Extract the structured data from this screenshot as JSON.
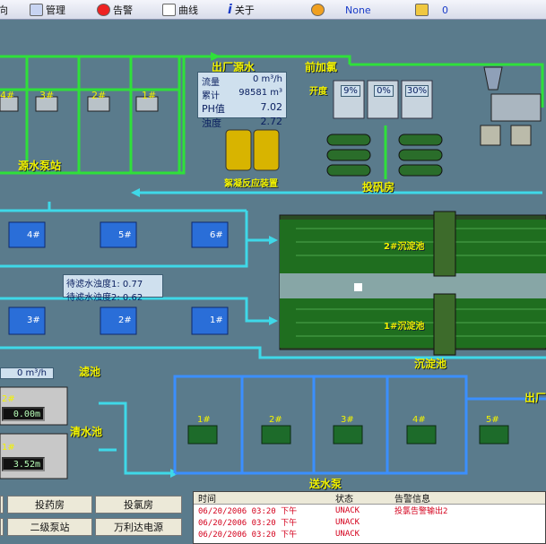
{
  "toolbar": {
    "partial_left": "向",
    "manage": "管理",
    "alarm": "告警",
    "curve": "曲线",
    "about": "关于",
    "user": "None",
    "count": "0"
  },
  "labels": {
    "source_station": "源水泵站",
    "outlet_water": "出厂源水",
    "front_chlorine": "前加氯",
    "open": "开度",
    "dosing_room": "投矾房",
    "filter": "滤池",
    "sed_tank": "沉淀池",
    "clear_pool": "清水池",
    "pump_station": "送水泵",
    "outlet": "出厂",
    "stirrer": "絮凝反应装置",
    "sed_2": "2#沉淀池",
    "sed_1": "1#沉淀池"
  },
  "outlet_stats": {
    "rows": [
      {
        "label": "流量",
        "value": "0",
        "unit": "m³/h"
      },
      {
        "label": "累计",
        "value": "98581",
        "unit": "m³"
      },
      {
        "label": "PH值",
        "value": "7.02",
        "unit": ""
      },
      {
        "label": "浊度",
        "value": "2.72",
        "unit": ""
      }
    ]
  },
  "dosing": {
    "openings": [
      "9%",
      "0%",
      "30%"
    ]
  },
  "filter_turbidity": {
    "row1": "待滤水浊度1: 0.77",
    "row2": "待滤水浊度2: 0.62",
    "flow": "0   m³/h"
  },
  "pumps_top": [
    "4#",
    "3#",
    "2#",
    "1#"
  ],
  "filters_top": [
    "4#",
    "5#",
    "6#"
  ],
  "filters_bottom": [
    "3#",
    "2#",
    "1#"
  ],
  "clear_readouts": [
    "0.00m",
    "3.52m"
  ],
  "clear_tags": [
    "2#",
    "1#"
  ],
  "send_pumps": [
    "1#",
    "2#",
    "3#",
    "4#",
    "5#"
  ],
  "nav_buttons": [
    {
      "label": ""
    },
    {
      "label": "投药房"
    },
    {
      "label": "投氯房"
    },
    {
      "label": ""
    },
    {
      "label": "二级泵站"
    },
    {
      "label": "万利达电源"
    }
  ],
  "alarm_table": {
    "headers": [
      "时间",
      "状态",
      "告警信息"
    ],
    "rows": [
      {
        "time": "06/20/2006 03:20 下午",
        "status": "UNACK",
        "info": "投氯告警输出2"
      },
      {
        "time": "06/20/2006 03:20 下午",
        "status": "UNACK",
        "info": ""
      },
      {
        "time": "06/20/2006 03:20 下午",
        "status": "UNACK",
        "info": ""
      }
    ]
  },
  "colors": {
    "background": "#5a7b8c",
    "green_pipe": "#2fe03a",
    "cyan_pipe": "#3fd8e8",
    "blue_pipe": "#3b8fff",
    "label_yellow": "#f2f200"
  }
}
